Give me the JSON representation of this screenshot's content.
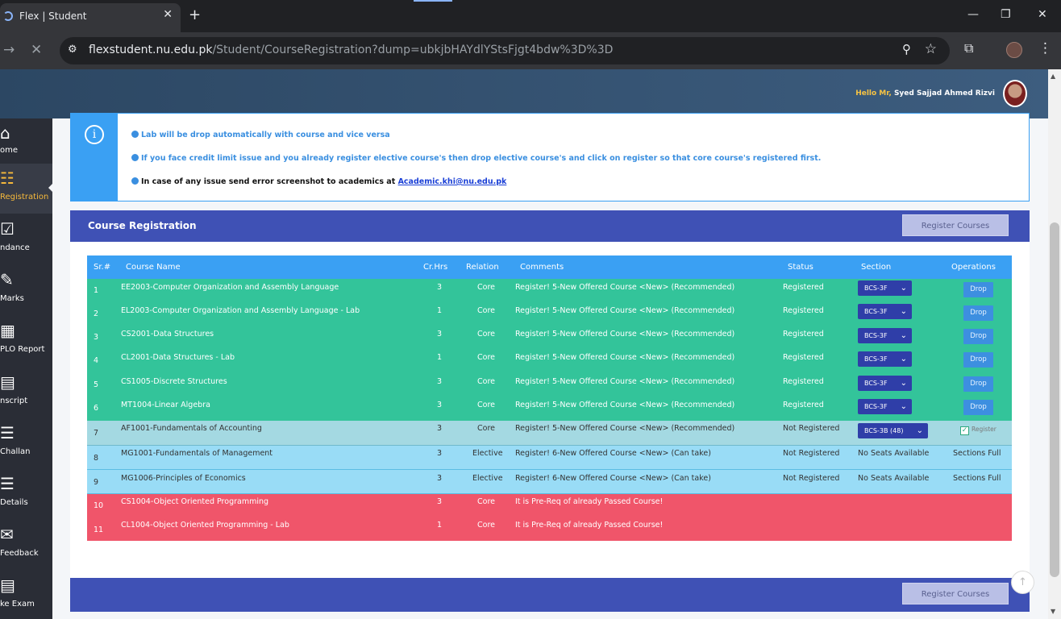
{
  "browser": {
    "tab_title": "Flex | Student",
    "tab_close": "✕",
    "new_tab": "+",
    "url_host": "flexstudent.nu.edu.pk",
    "url_path": "/Student/CourseRegistration?dump=ubkjbHAYdlYStsFjgt4bdw%3D%3D",
    "window_controls": [
      "—",
      "❐",
      "✕"
    ]
  },
  "header": {
    "greeting": "Hello Mr,",
    "user_name": "Syed Sajjad Ahmed Rizvi"
  },
  "sidebar": {
    "items": [
      {
        "label": "ome",
        "icon": "home-icon",
        "glyph": "⌂"
      },
      {
        "label": "Registration",
        "icon": "registration-icon",
        "glyph": "☷"
      },
      {
        "label": "ndance",
        "icon": "attendance-icon",
        "glyph": "☑"
      },
      {
        "label": "Marks",
        "icon": "marks-icon",
        "glyph": "✎"
      },
      {
        "label": "PLO Report",
        "icon": "report-icon",
        "glyph": "▦"
      },
      {
        "label": "nscript",
        "icon": "transcript-icon",
        "glyph": "▤"
      },
      {
        "label": "Challan",
        "icon": "challan-icon",
        "glyph": "☰"
      },
      {
        "label": "Details",
        "icon": "details-icon",
        "glyph": "☰"
      },
      {
        "label": "Feedback",
        "icon": "feedback-icon",
        "glyph": "✉"
      },
      {
        "label": "ke Exam",
        "icon": "exam-icon",
        "glyph": "▤"
      }
    ]
  },
  "notice": {
    "lines": [
      "Lab will be drop automatically with course and vice versa",
      "If you face credit limit issue and you already register elective course's then drop elective course's and click on register so that core course's registered first."
    ],
    "contact_text": "In case of any issue send error screenshot to academics at",
    "contact_email": "Academic.khi@nu.edu.pk"
  },
  "registration": {
    "title": "Course Registration",
    "register_button": "Register Courses",
    "columns": [
      "Sr.#",
      "Course Name",
      "Cr.Hrs",
      "Relation",
      "Comments",
      "Status",
      "Section",
      "Operations"
    ],
    "rows": [
      {
        "sr": "1",
        "course": "EE2003-Computer Organization and Assembly Language",
        "crhrs": "3",
        "relation": "Core",
        "comment": "Register! 5-New Offered Course <New> (Recommended)",
        "status": "Registered",
        "section": "BCS-3F",
        "operation": "Drop",
        "kind": "green"
      },
      {
        "sr": "2",
        "course": "EL2003-Computer Organization and Assembly Language - Lab",
        "crhrs": "1",
        "relation": "Core",
        "comment": "Register! 5-New Offered Course <New> (Recommended)",
        "status": "Registered",
        "section": "BCS-3F",
        "operation": "Drop",
        "kind": "green"
      },
      {
        "sr": "3",
        "course": "CS2001-Data Structures",
        "crhrs": "3",
        "relation": "Core",
        "comment": "Register! 5-New Offered Course <New> (Recommended)",
        "status": "Registered",
        "section": "BCS-3F",
        "operation": "Drop",
        "kind": "green"
      },
      {
        "sr": "4",
        "course": "CL2001-Data Structures - Lab",
        "crhrs": "1",
        "relation": "Core",
        "comment": "Register! 5-New Offered Course <New> (Recommended)",
        "status": "Registered",
        "section": "BCS-3F",
        "operation": "Drop",
        "kind": "green"
      },
      {
        "sr": "5",
        "course": "CS1005-Discrete Structures",
        "crhrs": "3",
        "relation": "Core",
        "comment": "Register! 5-New Offered Course <New> (Recommended)",
        "status": "Registered",
        "section": "BCS-3F",
        "operation": "Drop",
        "kind": "green"
      },
      {
        "sr": "6",
        "course": "MT1004-Linear Algebra",
        "crhrs": "3",
        "relation": "Core",
        "comment": "Register! 5-New Offered Course <New> (Recommended)",
        "status": "Registered",
        "section": "BCS-3F",
        "operation": "Drop",
        "kind": "green"
      },
      {
        "sr": "7",
        "course": "AF1001-Fundamentals of Accounting",
        "crhrs": "3",
        "relation": "Core",
        "comment": "Register! 5-New Offered Course <New> (Recommended)",
        "status": "Not Registered",
        "section": "BCS-3B (48)",
        "operation": "Register",
        "kind": "teal"
      },
      {
        "sr": "8",
        "course": "MG1001-Fundamentals of Management",
        "crhrs": "3",
        "relation": "Elective",
        "comment": "Register! 6-New Offered Course <New> (Can take)",
        "status": "Not Registered",
        "section": "No Seats Available",
        "operation": "Sections Full",
        "kind": "sky"
      },
      {
        "sr": "9",
        "course": "MG1006-Principles of Economics",
        "crhrs": "3",
        "relation": "Elective",
        "comment": "Register! 6-New Offered Course <New> (Can take)",
        "status": "Not Registered",
        "section": "No Seats Available",
        "operation": "Sections Full",
        "kind": "sky"
      },
      {
        "sr": "10",
        "course": "CS1004-Object Oriented Programming",
        "crhrs": "3",
        "relation": "Core",
        "comment": "It is Pre-Req of already Passed Course!",
        "status": "",
        "section": "",
        "operation": "",
        "kind": "red"
      },
      {
        "sr": "11",
        "course": "CL1004-Object Oriented Programming - Lab",
        "crhrs": "1",
        "relation": "Core",
        "comment": "It is Pre-Req of already Passed Course!",
        "status": "",
        "section": "",
        "operation": "",
        "kind": "red"
      }
    ]
  }
}
